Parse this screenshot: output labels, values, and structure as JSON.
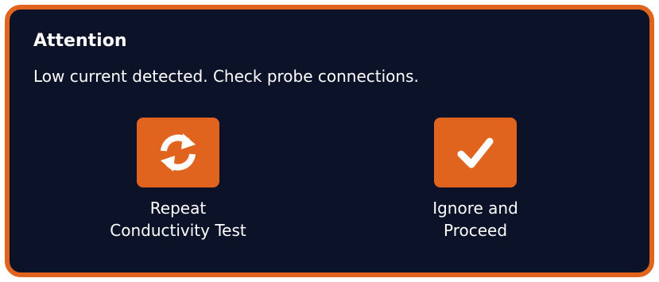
{
  "dialog": {
    "title": "Attention",
    "message": "Low current detected. Check probe connections."
  },
  "actions": [
    {
      "label": "Repeat\nConductivity Test",
      "icon": "repeat-icon"
    },
    {
      "label": "Ignore and\nProceed",
      "icon": "checkmark-icon"
    }
  ],
  "colors": {
    "accent": "#e0641e",
    "background": "#0c1329",
    "text": "#ffffff"
  }
}
